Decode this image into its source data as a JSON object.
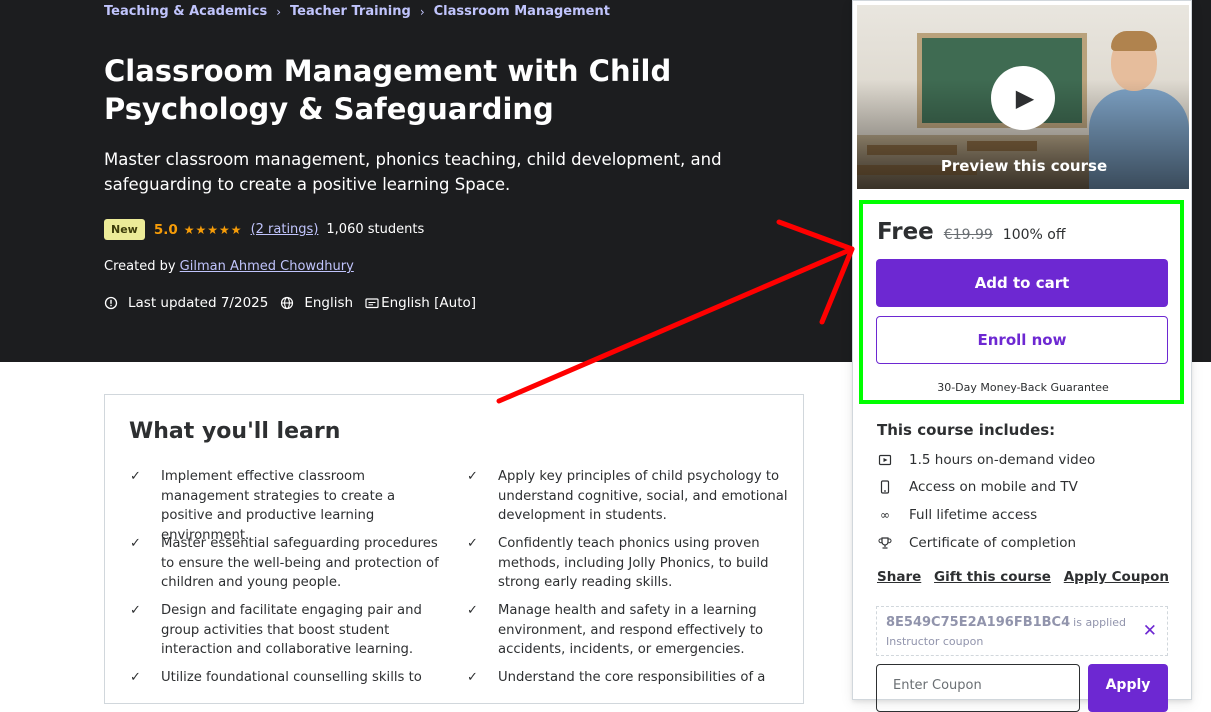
{
  "breadcrumb": {
    "items": [
      "Teaching & Academics",
      "Teacher Training",
      "Classroom Management"
    ]
  },
  "course": {
    "title": "Classroom Management with Child Psychology & Safeguarding",
    "subtitle": "Master classroom management, phonics teaching, child development, and safeguarding to create a positive learning Space.",
    "badge": "New",
    "rating": "5.0",
    "ratings_link": "(2 ratings)",
    "students": "1,060 students",
    "created_by_label": "Created by",
    "instructor": "Gilman Ahmed Chowdhury",
    "last_updated": "Last updated 7/2025",
    "language": "English",
    "captions": "English [Auto]"
  },
  "learn": {
    "title": "What you'll learn",
    "items": [
      "Implement effective classroom management strategies to create a positive and productive learning environment.",
      "Apply key principles of child psychology to understand cognitive, social, and emotional development in students.",
      "Master essential safeguarding procedures to ensure the well-being and protection of children and young people.",
      "Confidently teach phonics using proven methods, including Jolly Phonics, to build strong early reading skills.",
      "Design and facilitate engaging pair and group activities that boost student interaction and collaborative learning.",
      "Manage health and safety in a learning environment, and respond effectively to accidents, incidents, or emergencies.",
      "Utilize foundational counselling skills to",
      "Understand the core responsibilities of a"
    ]
  },
  "sidebar": {
    "preview_label": "Preview this course",
    "price": "Free",
    "old_price": "€19.99",
    "discount": "100% off",
    "add_to_cart": "Add to cart",
    "enroll_now": "Enroll now",
    "guarantee": "30-Day Money-Back Guarantee",
    "includes_title": "This course includes:",
    "includes": [
      {
        "icon": "video-icon",
        "text": "1.5 hours on-demand video"
      },
      {
        "icon": "mobile-icon",
        "text": "Access on mobile and TV"
      },
      {
        "icon": "infinity-icon",
        "text": "Full lifetime access"
      },
      {
        "icon": "trophy-icon",
        "text": "Certificate of completion"
      }
    ],
    "share": "Share",
    "gift": "Gift this course",
    "apply_coupon": "Apply Coupon",
    "coupon_code": "8E549C75E2A196FB1BC4",
    "coupon_applied": "is applied",
    "coupon_type": "Instructor coupon",
    "coupon_placeholder": "Enter Coupon",
    "apply": "Apply"
  },
  "colors": {
    "hero_bg": "#1c1d1f",
    "accent": "#6d28d2",
    "link": "#c0c4fc",
    "star": "#f69c08",
    "highlight": "#00ff00",
    "annotation_arrow": "#ff0000"
  }
}
